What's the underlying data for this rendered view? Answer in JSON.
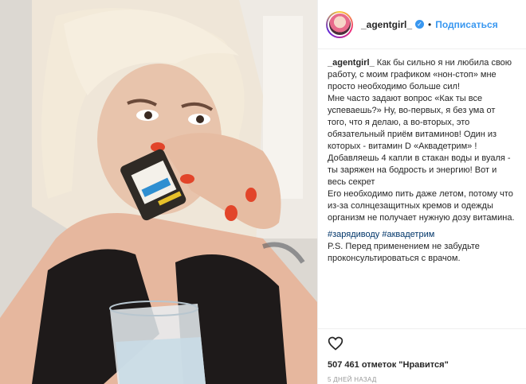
{
  "post": {
    "username": "_agentgirl_",
    "follow_label": "Подписаться",
    "separator": "•",
    "caption_user": "_agentgirl_",
    "caption_lines": [
      "Как бы сильно я ни любила свою работу, с моим графиком «нон-стоп» мне просто необходимо больше сил!",
      "Мне часто задают вопрос «Как ты все успеваешь?» Ну, во-первых, я без ума от того, что я делаю, а во-вторых, это обязательный приём витаминов! Один из которых - витамин D «Аквадетрим» ! Добавляешь 4 капли в стакан воды и вуаля - ты заряжен на бодрость и энергию! Вот и весь секрет",
      "Его необходимо пить даже летом, потому что из-за солнцезащитных кремов и одежды организм не получает нужную дозу витамина."
    ],
    "hashtags": "#зарядиводу #аквадетрим",
    "ps_text": "P.S. Перед применением не забудьте проконсультироваться с врачом.",
    "likes_text": "507 461 отметок \"Нравится\"",
    "time_text": "5 ДНЕЙ НАЗАД"
  },
  "icons": {
    "heart": "heart-icon",
    "verified": "verified-badge-icon"
  },
  "colors": {
    "link": "#3897f0",
    "hashtag": "#003569"
  }
}
